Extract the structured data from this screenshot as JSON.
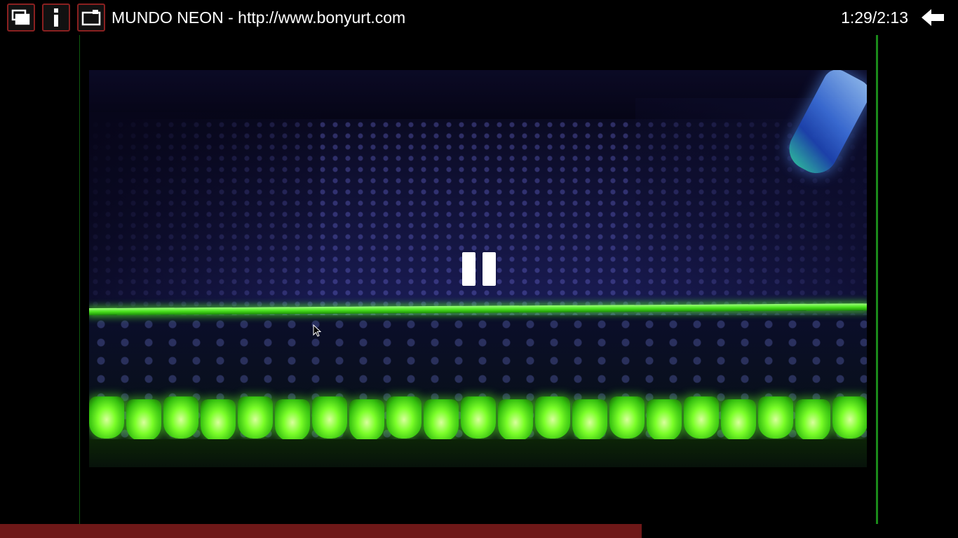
{
  "toolbar": {
    "buttons": [
      {
        "icon": "windows-icon"
      },
      {
        "icon": "info-icon"
      },
      {
        "icon": "window-toggle-icon"
      }
    ],
    "title": "MUNDO NEON - http://www.bonyurt.com",
    "time_display": "1:29/2:13",
    "back_icon": "back-arrow-icon"
  },
  "player": {
    "state": "paused",
    "overlay_icon": "pause-icon",
    "progress_fraction": 0.67
  },
  "colors": {
    "button_border": "#8a2020",
    "progress_fill": "#6e1818",
    "guide_line": "#1a8a1a"
  }
}
